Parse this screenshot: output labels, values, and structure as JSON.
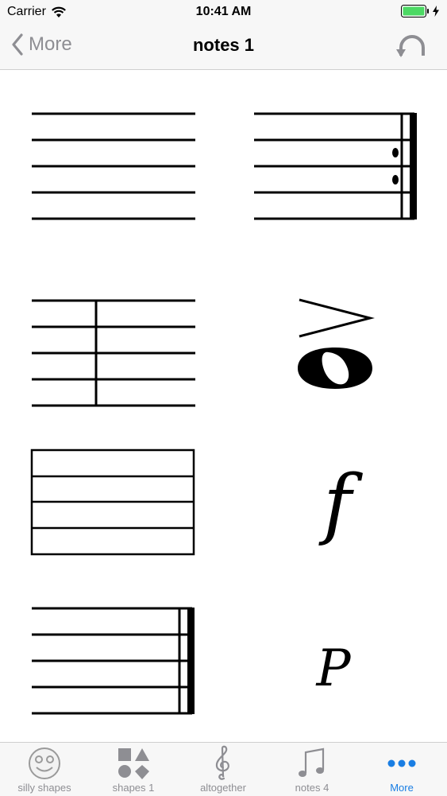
{
  "status_bar": {
    "carrier": "Carrier",
    "time": "10:41 AM"
  },
  "nav": {
    "back_label": "More",
    "title": "notes 1"
  },
  "tabs": [
    {
      "label": "silly shapes",
      "icon": "smiley-icon",
      "active": false
    },
    {
      "label": "shapes 1",
      "icon": "shapes-icon",
      "active": false
    },
    {
      "label": "altogether",
      "icon": "treble-clef-icon",
      "active": false
    },
    {
      "label": "notes 4",
      "icon": "music-note-icon",
      "active": false
    },
    {
      "label": "More",
      "icon": "more-dots-icon",
      "active": true
    }
  ],
  "symbols": {
    "forte": "f",
    "piano": "P"
  },
  "colors": {
    "accent": "#1a7ee3",
    "inactive": "#8e8e93",
    "battery": "#4cd964"
  }
}
